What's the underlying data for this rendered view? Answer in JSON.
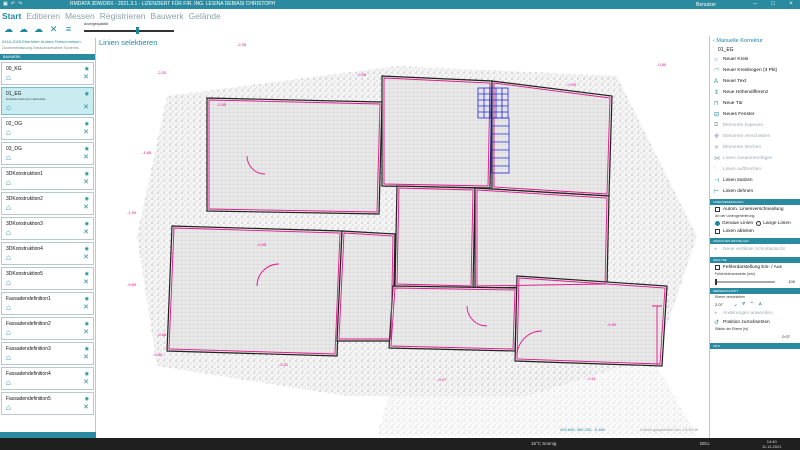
{
  "titlebar": {
    "title": "RMDATA 3DWORX - 2021.3.1 - LIZENZIERT FÜR FIR. ING. LESINA DEBIASI CHRISTOPH",
    "account": "Benutzer",
    "icons": [
      "save-icon",
      "undo-icon",
      "redo-icon"
    ]
  },
  "menu": {
    "items": [
      "Start",
      "Editieren",
      "Messen",
      "Registrieren",
      "Bauwerk",
      "Gelände"
    ],
    "active": "Start"
  },
  "toolbar": {
    "quality_label": "Anzeigequalität",
    "quality_value": 0.6
  },
  "left_panel": {
    "project_line1": "0416-2020 Eberhöfer Andrea Tertschnretsch",
    "project_line2": "Zusammenfassung Gebäudeaufnahme Tscherms",
    "section_label": "BAUWERK",
    "levels": [
      {
        "name": "00_KG",
        "sub": ""
      },
      {
        "name": "01_EG",
        "sub": "Erdstelle Referenz Höhenlinie"
      },
      {
        "name": "02_OG",
        "sub": ""
      },
      {
        "name": "03_DG",
        "sub": ""
      },
      {
        "name": "3DKonstruktion1",
        "sub": ""
      },
      {
        "name": "3DKonstruktion2",
        "sub": ""
      },
      {
        "name": "3DKonstruktion3",
        "sub": ""
      },
      {
        "name": "3DKonstruktion4",
        "sub": ""
      },
      {
        "name": "3DKonstruktion5",
        "sub": ""
      },
      {
        "name": "Fassadendefinition1",
        "sub": ""
      },
      {
        "name": "Fassadendefinition2",
        "sub": ""
      },
      {
        "name": "Fassadendefinition3",
        "sub": ""
      },
      {
        "name": "Fassadendefinition4",
        "sub": ""
      },
      {
        "name": "Fassadendefinition5",
        "sub": ""
      }
    ],
    "selected_index": 1
  },
  "canvas": {
    "title": "Linien selektieren",
    "coordinates": "493.645, 490.232, -0.186",
    "save_status": "Zuletzt gespeichert um: 14:39:46",
    "elevation_labels": [
      "-2.35",
      "-2.20",
      "-2.55",
      "-1.85",
      "-1.90",
      "-0.95",
      "-0.69",
      "-0.35",
      "-0.66",
      "-0.40",
      "-0.31",
      "-0.27",
      "-0.59",
      "-0.11",
      "-0.05",
      "-0.80"
    ]
  },
  "right_panel": {
    "header": "Manuelle Korrektur",
    "level": "01_EG",
    "tools": [
      {
        "label": "Neuer Kreis",
        "icon": "circle-icon",
        "enabled": true
      },
      {
        "label": "Neuer Kreisbogen (3 Pkt)",
        "icon": "arc-icon",
        "enabled": true
      },
      {
        "label": "Neuer Text",
        "icon": "text-icon",
        "enabled": true
      },
      {
        "label": "Neue Höhendifferenz",
        "icon": "height-diff-icon",
        "enabled": true
      },
      {
        "label": "Neue Tür",
        "icon": "door-icon",
        "enabled": true
      },
      {
        "label": "Neues Fenster",
        "icon": "window-icon",
        "enabled": true
      },
      {
        "label": "Elemente kopieren",
        "icon": "copy-icon",
        "enabled": false
      },
      {
        "label": "Elemente verschieben",
        "icon": "move-icon",
        "enabled": false
      },
      {
        "label": "Elemente löschen",
        "icon": "delete-icon",
        "enabled": false
      },
      {
        "label": "Linien zusammenfügen",
        "icon": "join-icon",
        "enabled": false
      },
      {
        "label": "Linien aufbrechen",
        "icon": "split-icon",
        "enabled": false
      },
      {
        "label": "Linien stutzen",
        "icon": "trim-icon",
        "enabled": true
      },
      {
        "label": "Linien dehnen",
        "icon": "extend-icon",
        "enabled": true
      }
    ],
    "sections": {
      "lines": "LINIENVEREINIGUNG",
      "views": "ANSICHTEN ERSTELLEN",
      "analysis": "ANALYSE",
      "section": "EBENENSCHNITT",
      "info": "INFO"
    },
    "auto_join": "Autom. Linienverschneidung",
    "line_mode_label": "Art der Liniengenerierung",
    "exact_lines": "Genaue Linien",
    "long_lines": "Lange Linien",
    "derive_lines": "Linien ableiten",
    "new_vertical_section": "Neue vertikale Schnittansicht",
    "error_display": "Fehlerdarstellung Ein- / Aus",
    "tolerance_label": "Fehlertoleranzwerte [mm]",
    "tolerance_value": "100",
    "shift_plane": "Ebene verschieben",
    "shift_value": "2.07",
    "apply_changes": "Änderungen anwenden",
    "reset_position": "Position zurücksetzen",
    "thickness_label": "Stärke der Ebene [m]",
    "thickness_value": "0.07"
  },
  "taskbar": {
    "weather": "15°C Sonnig",
    "tray": "DEU",
    "time": "14:40",
    "date": "11.11.2021"
  }
}
